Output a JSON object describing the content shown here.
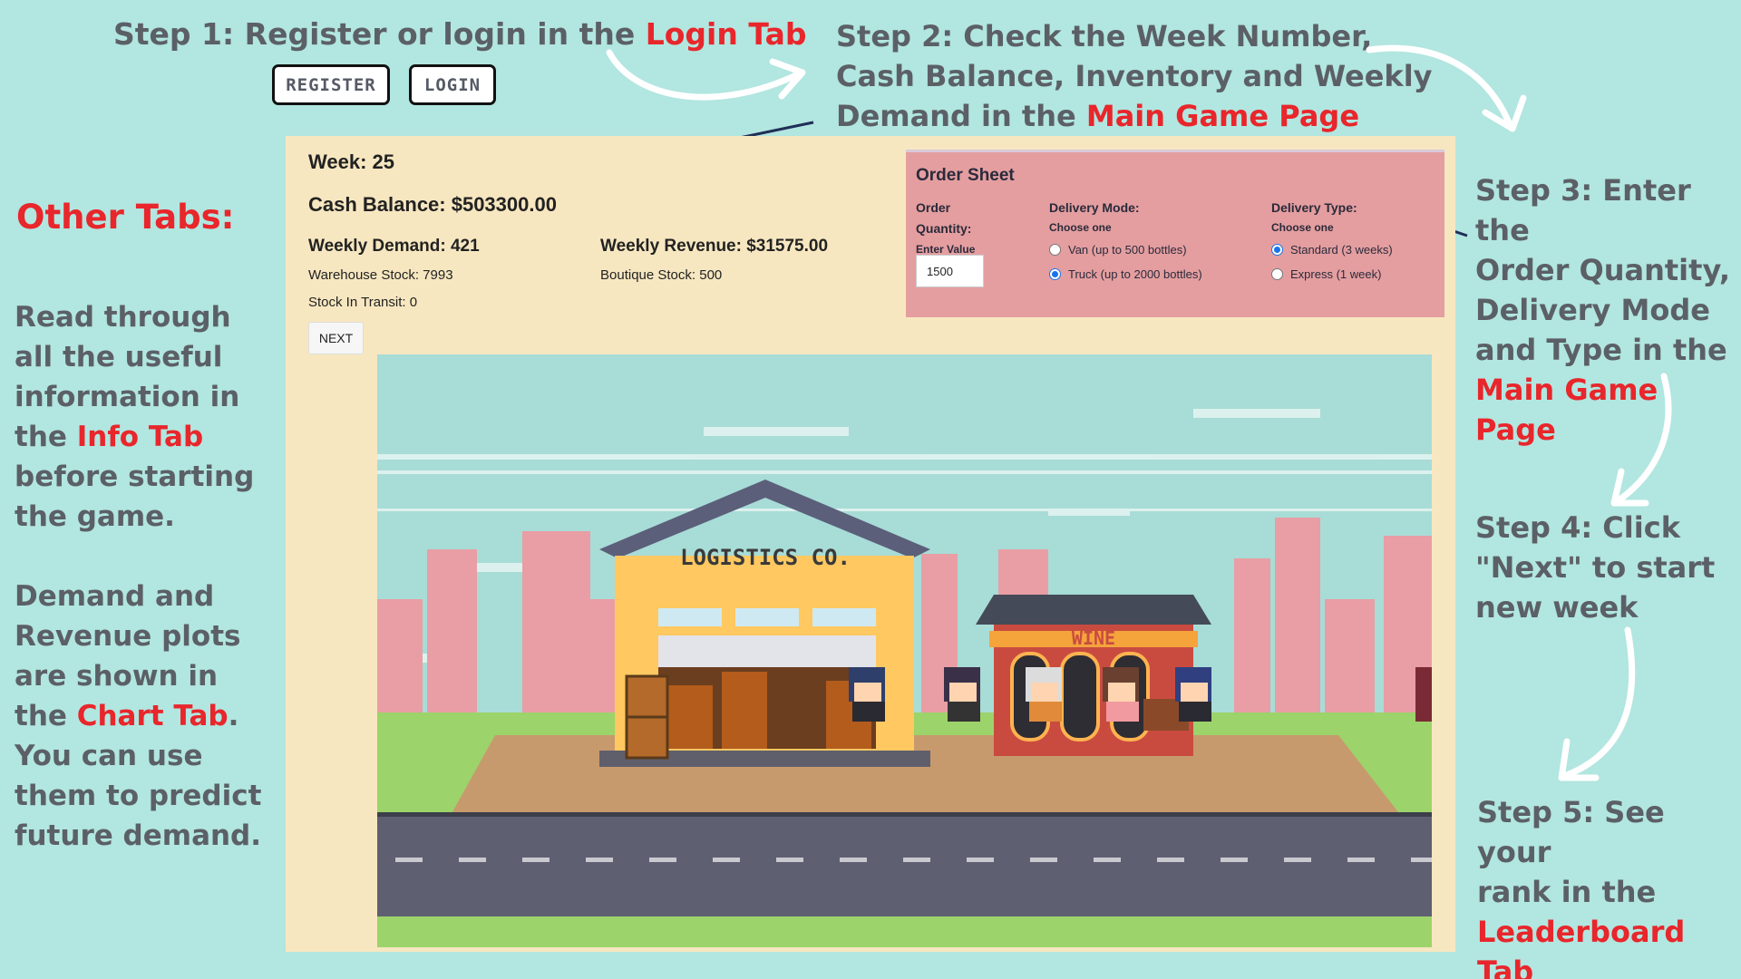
{
  "step1": {
    "text": "Step 1: Register or login in  the ",
    "highlight": "Login Tab",
    "register": "REGISTER",
    "login": "LOGIN"
  },
  "step2": {
    "line1": "Step 2:  Check the Week Number,",
    "line2": "Cash Balance, Inventory and Weekly",
    "line3": "Demand in the ",
    "highlight": "Main Game Page"
  },
  "step3": {
    "line1": "Step 3:  Enter the",
    "line2": "Order Quantity,",
    "line3": "Delivery Mode",
    "line4": "and Type in  the",
    "highlight": "Main Game Page"
  },
  "step4": {
    "line1": "Step 4:  Click",
    "line2": "\"Next\"  to start",
    "line3": "new week"
  },
  "step5": {
    "line1": "Step 5:  See your",
    "line2": "rank in  the",
    "highlight": "Leaderboard Tab"
  },
  "left": {
    "title": "Other Tabs:",
    "p1_a": "Read through all the  useful information in the ",
    "p1_hl": "Info Tab",
    "p1_b": " before starting the game.",
    "p2_a": "Demand and Revenue plots are shown in the ",
    "p2_hl": "Chart Tab",
    "p2_b": ". You can use them to predict future demand."
  },
  "game": {
    "week": "Week:  25",
    "cash": "Cash Balance:  $503300.00",
    "demand": "Weekly Demand:  421",
    "revenue": "Weekly Revenue:  $31575.00",
    "warehouse": "Warehouse Stock:  7993",
    "boutique": "Boutique Stock:  500",
    "transit": "Stock In Transit:  0",
    "next": "NEXT"
  },
  "order": {
    "title": "Order Sheet",
    "qty_label1": "Order",
    "qty_label2": "Quantity:",
    "qty_sub": "Enter Value",
    "qty_value": "1500",
    "mode_label": "Delivery Mode:",
    "mode_sub": "Choose one",
    "mode_van": "Van (up to 500 bottles)",
    "mode_truck": "Truck (up to 2000 bottles)",
    "type_label": "Delivery Type:",
    "type_sub": "Choose one",
    "type_standard": "Standard (3 weeks)",
    "type_express": "Express (1 week)"
  },
  "scene": {
    "warehouse_sign": "LOGISTICS CO.",
    "shop_sign": "WINE"
  }
}
